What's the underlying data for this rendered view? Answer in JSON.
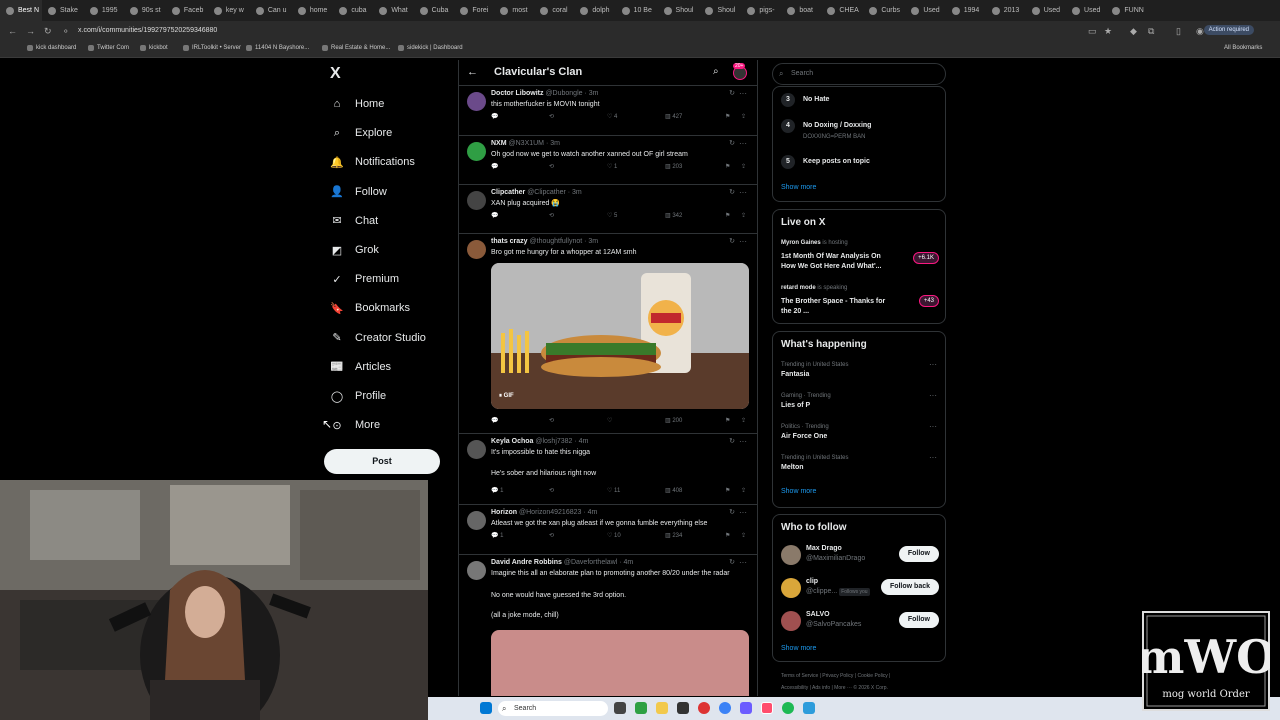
{
  "browser": {
    "tabs": [
      "Best N",
      "Stake",
      "1995",
      "90s st",
      "Faceb",
      "key w",
      "Can u",
      "home",
      "cuba",
      "What",
      "Cuba",
      "Forei",
      "most",
      "coral",
      "dolph",
      "10 Be",
      "Shoul",
      "Shoul",
      "pigs-",
      "boat",
      "CHEA",
      "Curbs",
      "Used",
      "1994",
      "2013",
      "Used",
      "Used",
      "FUNN"
    ],
    "url": "x.com/i/communities/1992797520259346880",
    "action_required": "Action required",
    "bookmarks": [
      "kick dashboard",
      "Twitter Com",
      "kickbot",
      "IRLToolkit • Server",
      "11404 N Bayshore...",
      "Real Estate & Home...",
      "sidekick | Dashboard"
    ],
    "all_bookmarks": "All Bookmarks"
  },
  "nav": {
    "logo": "X",
    "items": [
      "Home",
      "Explore",
      "Notifications",
      "Follow",
      "Chat",
      "Grok",
      "Premium",
      "Bookmarks",
      "Creator Studio",
      "Articles",
      "Profile",
      "More"
    ],
    "post": "Post"
  },
  "header": {
    "title": "Clavicular's Clan",
    "badge": "20+"
  },
  "tweets": [
    {
      "name": "Doctor Libowitz",
      "handle": "@Dubongle · 3m",
      "text": "this motherfucker is MOVIN tonight",
      "likes": "4",
      "views": "427"
    },
    {
      "name": "NXM",
      "handle": "@N3X1UM · 3m",
      "text": "Oh god now we get to watch another xanned out OF girl stream",
      "likes": "1",
      "views": "203"
    },
    {
      "name": "Clipcather",
      "handle": "@Clipcather · 3m",
      "text": "XAN plug acquired 😭",
      "likes": "5",
      "views": "342"
    },
    {
      "name": "thats crazy",
      "handle": "@thoughtfullynot · 3m",
      "text": "Bro got me hungry for a whopper at 12AM smh",
      "media_label": "GIF",
      "views": "200"
    },
    {
      "name": "Keyla Ochoa",
      "handle": "@loshj7382 · 4m",
      "text": "It's impossible to hate this nigga",
      "text2": "He's sober and hilarious right now",
      "replies": "1",
      "likes": "11",
      "views": "408"
    },
    {
      "name": "Horizon",
      "handle": "@Horizon49216823 · 4m",
      "text": "Atleast we got the xan plug atleast if we gonna fumble everything else",
      "replies": "1",
      "likes": "10",
      "views": "234"
    },
    {
      "name": "David Andre Robbins",
      "handle": "@Daveforthelawl · 4m",
      "text": "Imagine this all an elaborate plan to promoting another 80/20 under the radar",
      "text2": "No one would have guessed the 3rd option.",
      "text3": "(all a joke mode, chill)"
    }
  ],
  "right": {
    "search_placeholder": "Search",
    "rules": [
      {
        "num": "3",
        "title": "No Hate",
        "sub": ""
      },
      {
        "num": "4",
        "title": "No Doxing / Doxxing",
        "sub": "DOXXING=PERM BAN"
      },
      {
        "num": "5",
        "title": "Keep posts on topic",
        "sub": ""
      }
    ],
    "show_more": "Show more",
    "live_title": "Live on X",
    "live": [
      {
        "host": "Myron Gaines",
        "status": "is hosting",
        "title": "1st Month Of War Analysis On How We Got Here And What'...",
        "count": "+6.1K"
      },
      {
        "host": "retard mode",
        "status": "is speaking",
        "title": "The Brother Space - Thanks for the 20 ...",
        "count": "+43"
      }
    ],
    "happening_title": "What's happening",
    "trends": [
      {
        "context": "Trending in United States",
        "name": "Fantasia"
      },
      {
        "context": "Gaming · Trending",
        "name": "Lies of P"
      },
      {
        "context": "Politics · Trending",
        "name": "Air Force One"
      },
      {
        "context": "Trending in United States",
        "name": "Melton"
      }
    ],
    "wtf_title": "Who to follow",
    "wtf": [
      {
        "name": "Max Drago",
        "handle": "@MaximilianDrago",
        "button": "Follow"
      },
      {
        "name": "clip",
        "handle": "@clippe...",
        "badge": "Follows you",
        "button": "Follow back"
      },
      {
        "name": "SALVO",
        "handle": "@SalvoPancakes",
        "button": "Follow"
      }
    ],
    "footer1": "Terms of Service   |   Privacy Policy   |   Cookie Policy   |",
    "footer2": "Accessibility   |   Ads info   |   More ···   © 2026 X Corp."
  },
  "taskbar": {
    "search": "Search"
  },
  "overlay": {
    "logo_line1": "mWO",
    "logo_line2": "mog world Order"
  },
  "colors": {
    "accent": "#1d9bf0",
    "pink": "#f91880",
    "bg": "#000000"
  }
}
